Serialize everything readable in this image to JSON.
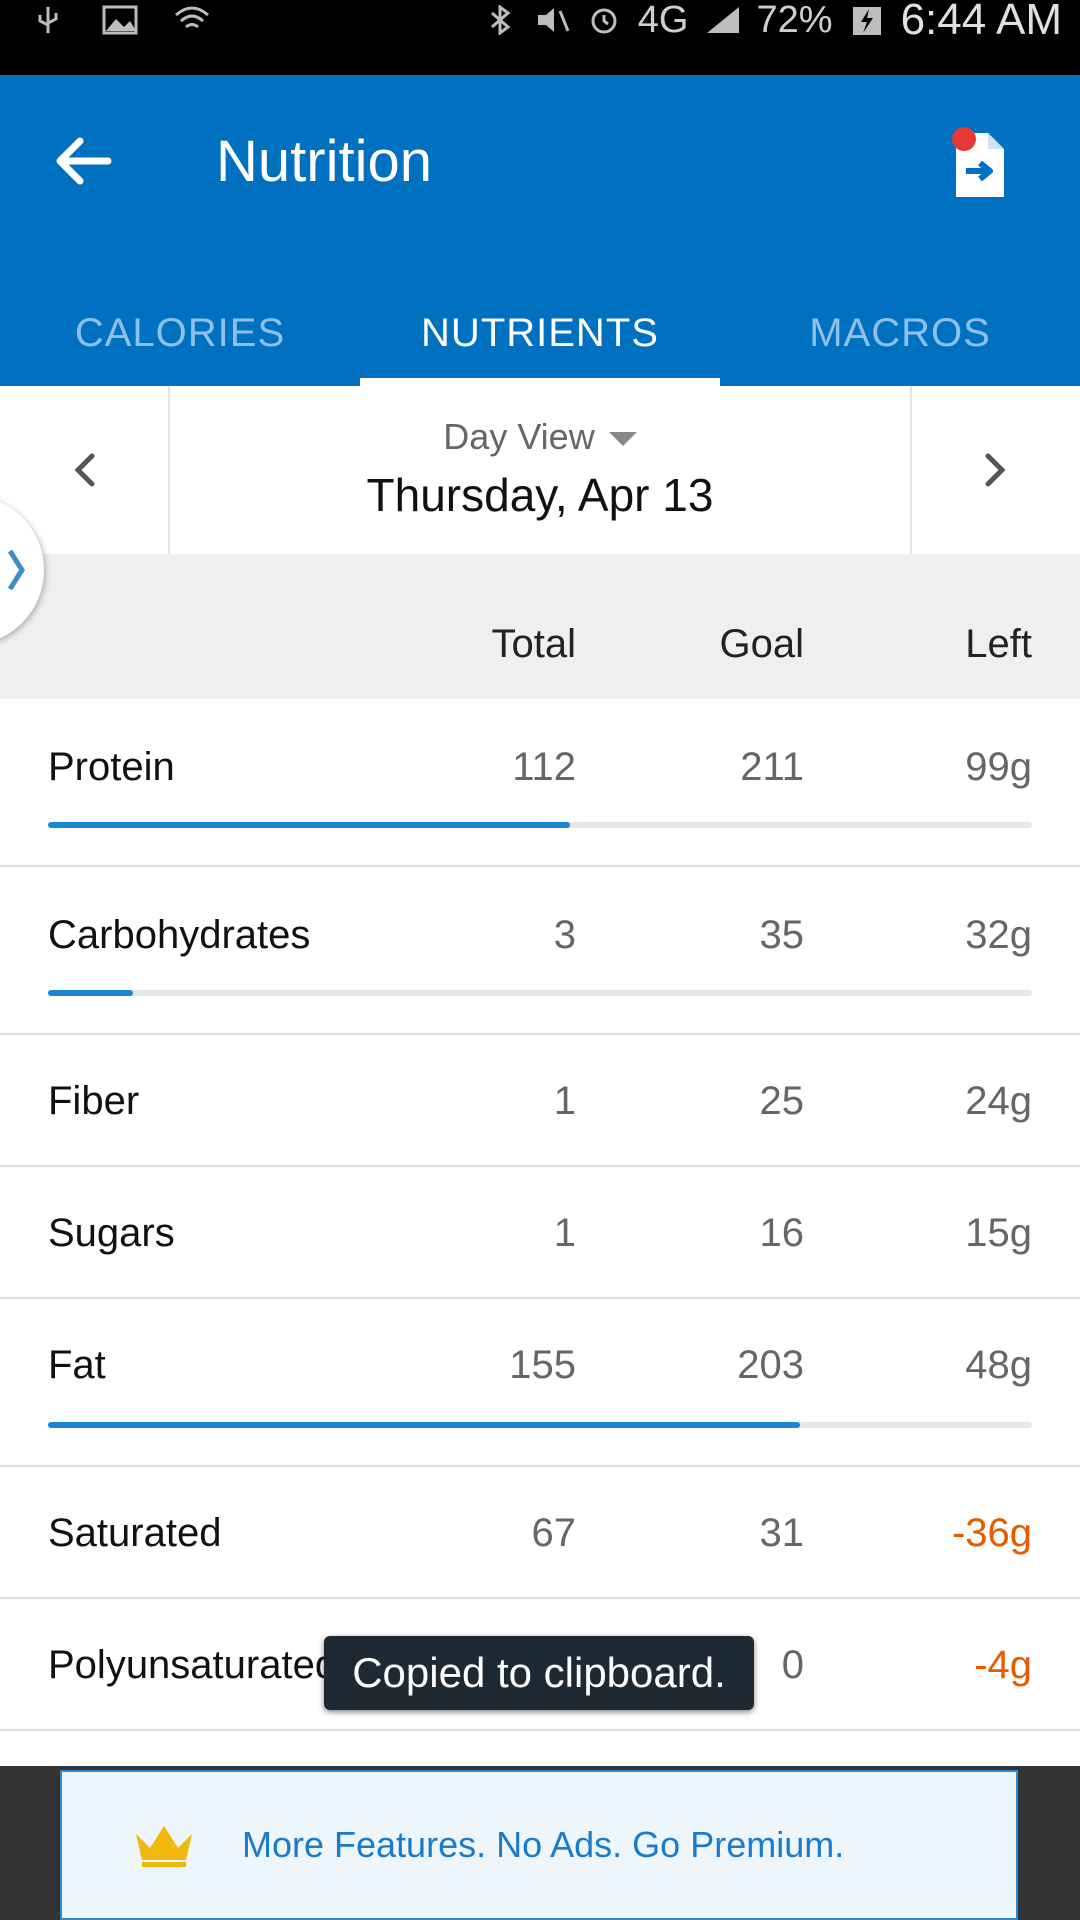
{
  "status_bar": {
    "battery": "72%",
    "time": "6:44 AM",
    "network": "4G"
  },
  "app_bar": {
    "title": "Nutrition",
    "tabs": [
      {
        "label": "CALORIES",
        "active": false
      },
      {
        "label": "NUTRIENTS",
        "active": true
      },
      {
        "label": "MACROS",
        "active": false
      }
    ]
  },
  "date_nav": {
    "view_label": "Day View",
    "date": "Thursday, Apr 13"
  },
  "table": {
    "headers": {
      "total": "Total",
      "goal": "Goal",
      "left": "Left"
    },
    "rows": [
      {
        "name": "Protein",
        "total": "112",
        "goal": "211",
        "left": "99g",
        "progress": 0.53
      },
      {
        "name": "Carbohydrates",
        "total": "3",
        "goal": "35",
        "left": "32g",
        "progress": 0.086
      },
      {
        "name": "Fiber",
        "total": "1",
        "goal": "25",
        "left": "24g"
      },
      {
        "name": "Sugars",
        "total": "1",
        "goal": "16",
        "left": "15g"
      },
      {
        "name": "Fat",
        "total": "155",
        "goal": "203",
        "left": "48g",
        "progress": 0.764
      },
      {
        "name": "Saturated",
        "total": "67",
        "goal": "31",
        "left": "-36g"
      },
      {
        "name": "Polyunsaturated",
        "total": "",
        "goal": "0",
        "left": "-4g"
      }
    ]
  },
  "toast": {
    "text": "Copied to clipboard."
  },
  "premium_banner": {
    "text": "More Features. No Ads. Go Premium."
  },
  "colors": {
    "app_bar": "#0070c0",
    "progress": "#1a86d6",
    "negative": "#e85a00",
    "premium_text": "#1a7cc9",
    "notification_dot": "#e53935",
    "crown": "#f2b90c"
  }
}
